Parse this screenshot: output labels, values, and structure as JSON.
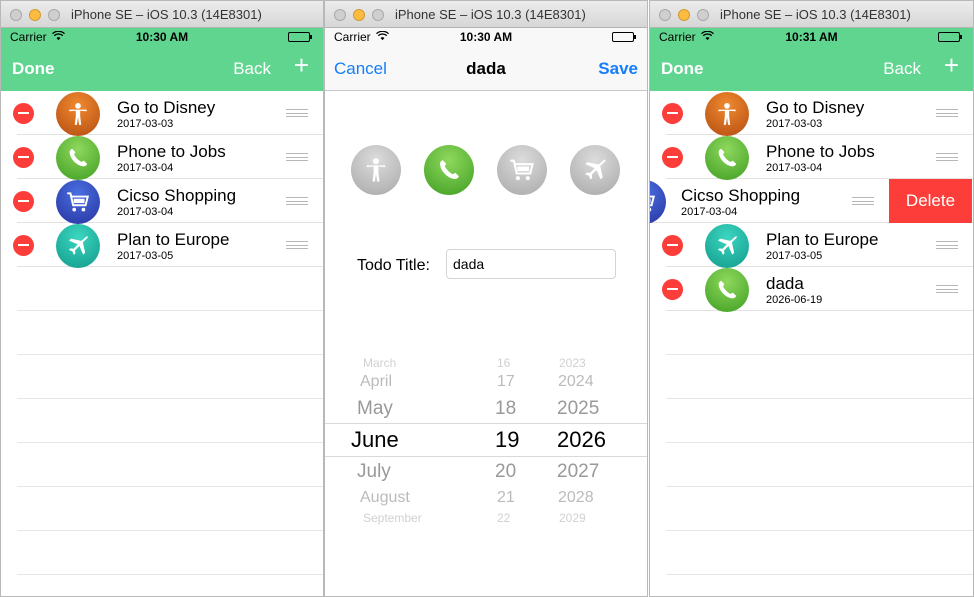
{
  "window_title": "iPhone SE – iOS 10.3 (14E8301)",
  "carrier": "Carrier",
  "screen1": {
    "time": "10:30 AM",
    "nav": {
      "left": "Done",
      "back": "Back",
      "add": "+"
    },
    "items": [
      {
        "title": "Go to Disney",
        "date": "2017-03-03",
        "icon": "person-icon"
      },
      {
        "title": "Phone to Jobs",
        "date": "2017-03-04",
        "icon": "phone-icon"
      },
      {
        "title": "Cicso Shopping",
        "date": "2017-03-04",
        "icon": "cart-icon"
      },
      {
        "title": "Plan to Europe",
        "date": "2017-03-05",
        "icon": "plane-icon"
      }
    ]
  },
  "screen2": {
    "time": "10:30 AM",
    "nav": {
      "cancel": "Cancel",
      "title": "dada",
      "save": "Save"
    },
    "selected_icon": "phone-icon",
    "form": {
      "label": "Todo Title:",
      "value": "dada"
    },
    "picker": {
      "months": [
        "March",
        "April",
        "May",
        "June",
        "July",
        "August",
        "September"
      ],
      "days": [
        "16",
        "17",
        "18",
        "19",
        "20",
        "21",
        "22"
      ],
      "years": [
        "2023",
        "2024",
        "2025",
        "2026",
        "2027",
        "2028",
        "2029"
      ],
      "selected": {
        "month": "June",
        "day": "19",
        "year": "2026"
      }
    }
  },
  "screen3": {
    "time": "10:31 AM",
    "nav": {
      "left": "Done",
      "back": "Back",
      "add": "+"
    },
    "delete_label": "Delete",
    "items": [
      {
        "title": "Go to Disney",
        "date": "2017-03-03",
        "icon": "person-icon"
      },
      {
        "title": "Phone to Jobs",
        "date": "2017-03-04",
        "icon": "phone-icon"
      },
      {
        "title": "Cicso Shopping",
        "date": "2017-03-04",
        "icon": "cart-icon"
      },
      {
        "title": "Plan to Europe",
        "date": "2017-03-05",
        "icon": "plane-icon"
      },
      {
        "title": "dada",
        "date": "2026-06-19",
        "icon": "phone-icon"
      }
    ]
  },
  "colors": {
    "nav_green": "#5fd58f",
    "delete_red": "#fc3d39",
    "ios_blue": "#147efb"
  }
}
